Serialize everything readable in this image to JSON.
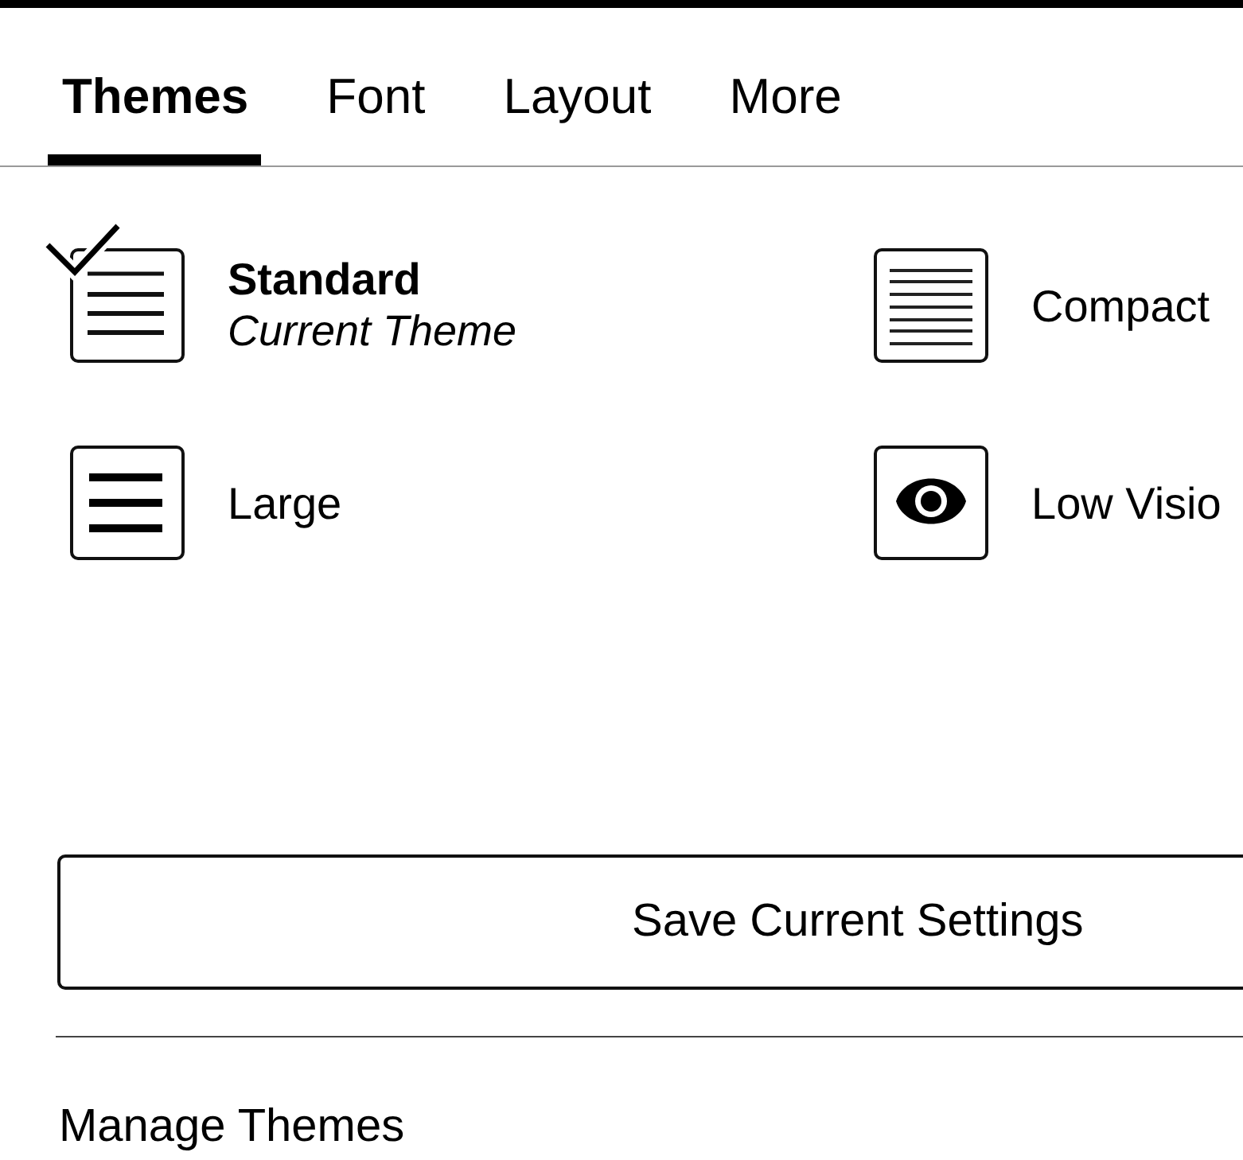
{
  "tabs": [
    {
      "label": "Themes",
      "selected": true
    },
    {
      "label": "Font",
      "selected": false
    },
    {
      "label": "Layout",
      "selected": false
    },
    {
      "label": "More",
      "selected": false
    }
  ],
  "themes": [
    {
      "kind": "standard",
      "name": "Standard",
      "subtitle": "Current Theme",
      "selected": true
    },
    {
      "kind": "compact",
      "name": "Compact",
      "selected": false
    },
    {
      "kind": "large",
      "name": "Large",
      "selected": false
    },
    {
      "kind": "low_vision",
      "name": "Low Visio",
      "selected": false
    }
  ],
  "save_button": {
    "label": "Save Current Settings"
  },
  "manage_themes": {
    "label": "Manage Themes"
  }
}
